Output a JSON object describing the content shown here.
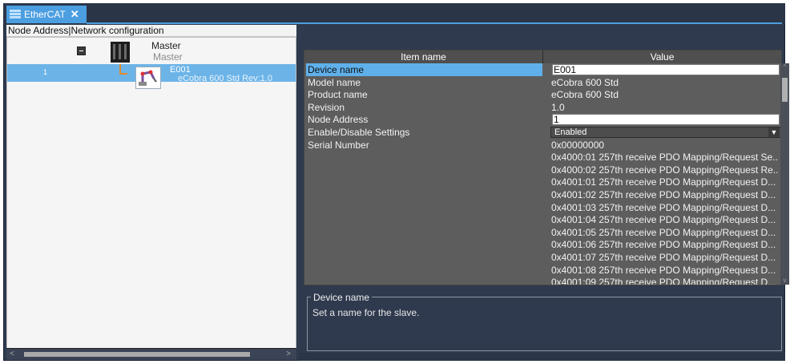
{
  "tab": {
    "label": "EtherCAT",
    "close": "✕"
  },
  "left": {
    "header": "Node Address|Network configuration",
    "master": {
      "title": "Master",
      "subtitle": "Master"
    },
    "slave": {
      "node_number": "1",
      "name": "E001",
      "model": "eCobra 600 Std Rev:1.0"
    },
    "scroll_left": "<",
    "scroll_right": ">"
  },
  "grid": {
    "columns": [
      "Item name",
      "Value"
    ],
    "rows": [
      {
        "name": "Device name",
        "value": "E001",
        "kind": "input",
        "selected": true
      },
      {
        "name": "Model name",
        "value": "eCobra 600 Std"
      },
      {
        "name": "Product name",
        "value": "eCobra 600 Std"
      },
      {
        "name": "Revision",
        "value": "1.0"
      },
      {
        "name": "Node Address",
        "value": "1",
        "kind": "input"
      },
      {
        "name": "Enable/Disable Settings",
        "value": "Enabled",
        "kind": "dropdown"
      },
      {
        "name": "Serial Number",
        "value": "0x00000000"
      },
      {
        "name": "",
        "value": "0x4000:01 257th receive PDO Mapping/Request Se..."
      },
      {
        "name": "",
        "value": "0x4000:02 257th receive PDO Mapping/Request Re..."
      },
      {
        "name": "",
        "value": "0x4001:01 257th receive PDO Mapping/Request D..."
      },
      {
        "name": "",
        "value": "0x4001:02 257th receive PDO Mapping/Request D..."
      },
      {
        "name": "",
        "value": "0x4001:03 257th receive PDO Mapping/Request D..."
      },
      {
        "name": "",
        "value": "0x4001:04 257th receive PDO Mapping/Request D..."
      },
      {
        "name": "",
        "value": "0x4001:05 257th receive PDO Mapping/Request D..."
      },
      {
        "name": "",
        "value": "0x4001:06 257th receive PDO Mapping/Request D..."
      },
      {
        "name": "",
        "value": "0x4001:07 257th receive PDO Mapping/Request D..."
      },
      {
        "name": "",
        "value": "0x4001:08 257th receive PDO Mapping/Request D..."
      },
      {
        "name": "",
        "value": "0x4001:09 257th receive PDO Mapping/Request D..."
      }
    ]
  },
  "description": {
    "title": "Device name",
    "text": "Set a name for the slave."
  },
  "colors": {
    "accent": "#4b9ee0",
    "selection": "#6cb4e8",
    "panel": "#2f3a4e",
    "grid": "#5d5d5d"
  }
}
